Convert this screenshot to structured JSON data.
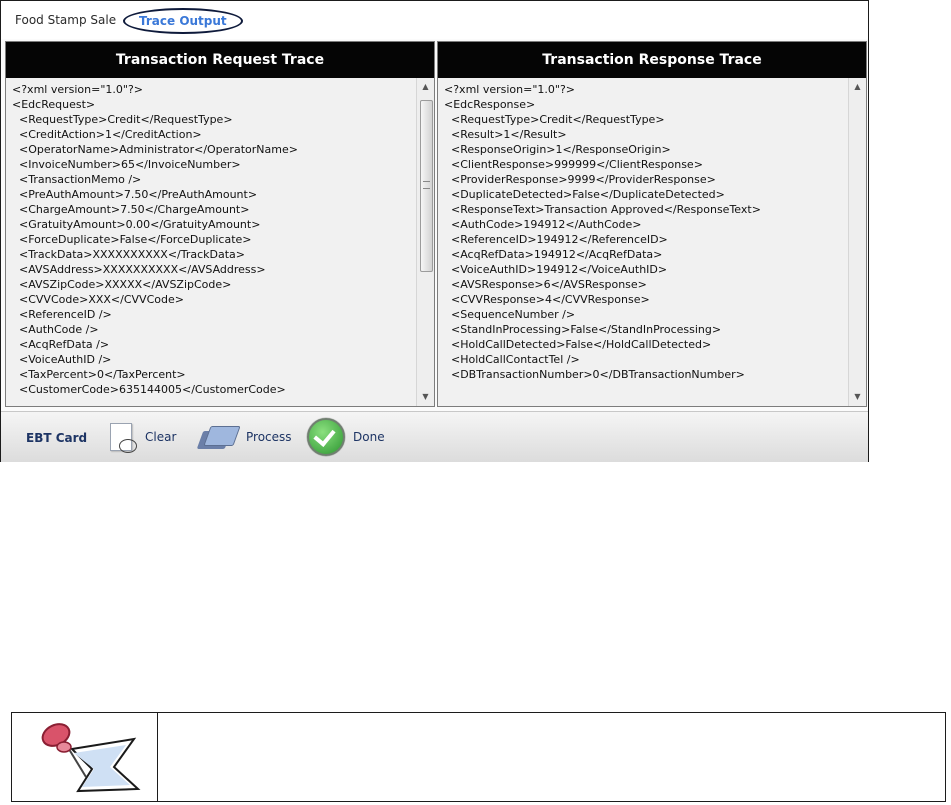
{
  "tabs": {
    "food_stamp_sale": "Food Stamp Sale",
    "trace_output": "Trace Output"
  },
  "request_panel": {
    "title": "Transaction Request Trace",
    "lines": [
      "<?xml version=\"1.0\"?>",
      "<EdcRequest>",
      "  <RequestType>Credit</RequestType>",
      "  <CreditAction>1</CreditAction>",
      "  <OperatorName>Administrator</OperatorName>",
      "  <InvoiceNumber>65</InvoiceNumber>",
      "  <TransactionMemo />",
      "  <PreAuthAmount>7.50</PreAuthAmount>",
      "  <ChargeAmount>7.50</ChargeAmount>",
      "  <GratuityAmount>0.00</GratuityAmount>",
      "  <ForceDuplicate>False</ForceDuplicate>",
      "  <TrackData>XXXXXXXXXX</TrackData>",
      "  <AVSAddress>XXXXXXXXXX</AVSAddress>",
      "  <AVSZipCode>XXXXX</AVSZipCode>",
      "  <CVVCode>XXX</CVVCode>",
      "  <ReferenceID />",
      "  <AuthCode />",
      "  <AcqRefData />",
      "  <VoiceAuthID />",
      "  <TaxPercent>0</TaxPercent>",
      "  <CustomerCode>635144005</CustomerCode>"
    ]
  },
  "response_panel": {
    "title": "Transaction Response Trace",
    "lines": [
      "<?xml version=\"1.0\"?>",
      "<EdcResponse>",
      "  <RequestType>Credit</RequestType>",
      "  <Result>1</Result>",
      "  <ResponseOrigin>1</ResponseOrigin>",
      "  <ClientResponse>999999</ClientResponse>",
      "  <ProviderResponse>9999</ProviderResponse>",
      "  <DuplicateDetected>False</DuplicateDetected>",
      "  <ResponseText>Transaction Approved</ResponseText>",
      "  <AuthCode>194912</AuthCode>",
      "  <ReferenceID>194912</ReferenceID>",
      "  <AcqRefData>194912</AcqRefData>",
      "  <VoiceAuthID>194912</VoiceAuthID>",
      "  <AVSResponse>6</AVSResponse>",
      "  <CVVResponse>4</CVVResponse>",
      "  <SequenceNumber />",
      "  <StandInProcessing>False</StandInProcessing>",
      "  <HoldCallDetected>False</HoldCallDetected>",
      "  <HoldCallContactTel />",
      "  <DBTransactionNumber>0</DBTransactionNumber>"
    ]
  },
  "toolbar": {
    "ebt_card_label": "EBT Card",
    "clear_label": "Clear",
    "process_label": "Process",
    "done_label": "Done"
  },
  "icons": {
    "clear": "scissors-paper-icon",
    "process": "credit-card-icon",
    "done": "check-circle-icon",
    "note": "pushpin-note-icon"
  },
  "colors": {
    "header_bg": "#050505",
    "header_text": "#ffffff",
    "active_tab_text": "#3a78d8",
    "toolbar_text": "#1d3464",
    "done_green": "#2c9530"
  }
}
